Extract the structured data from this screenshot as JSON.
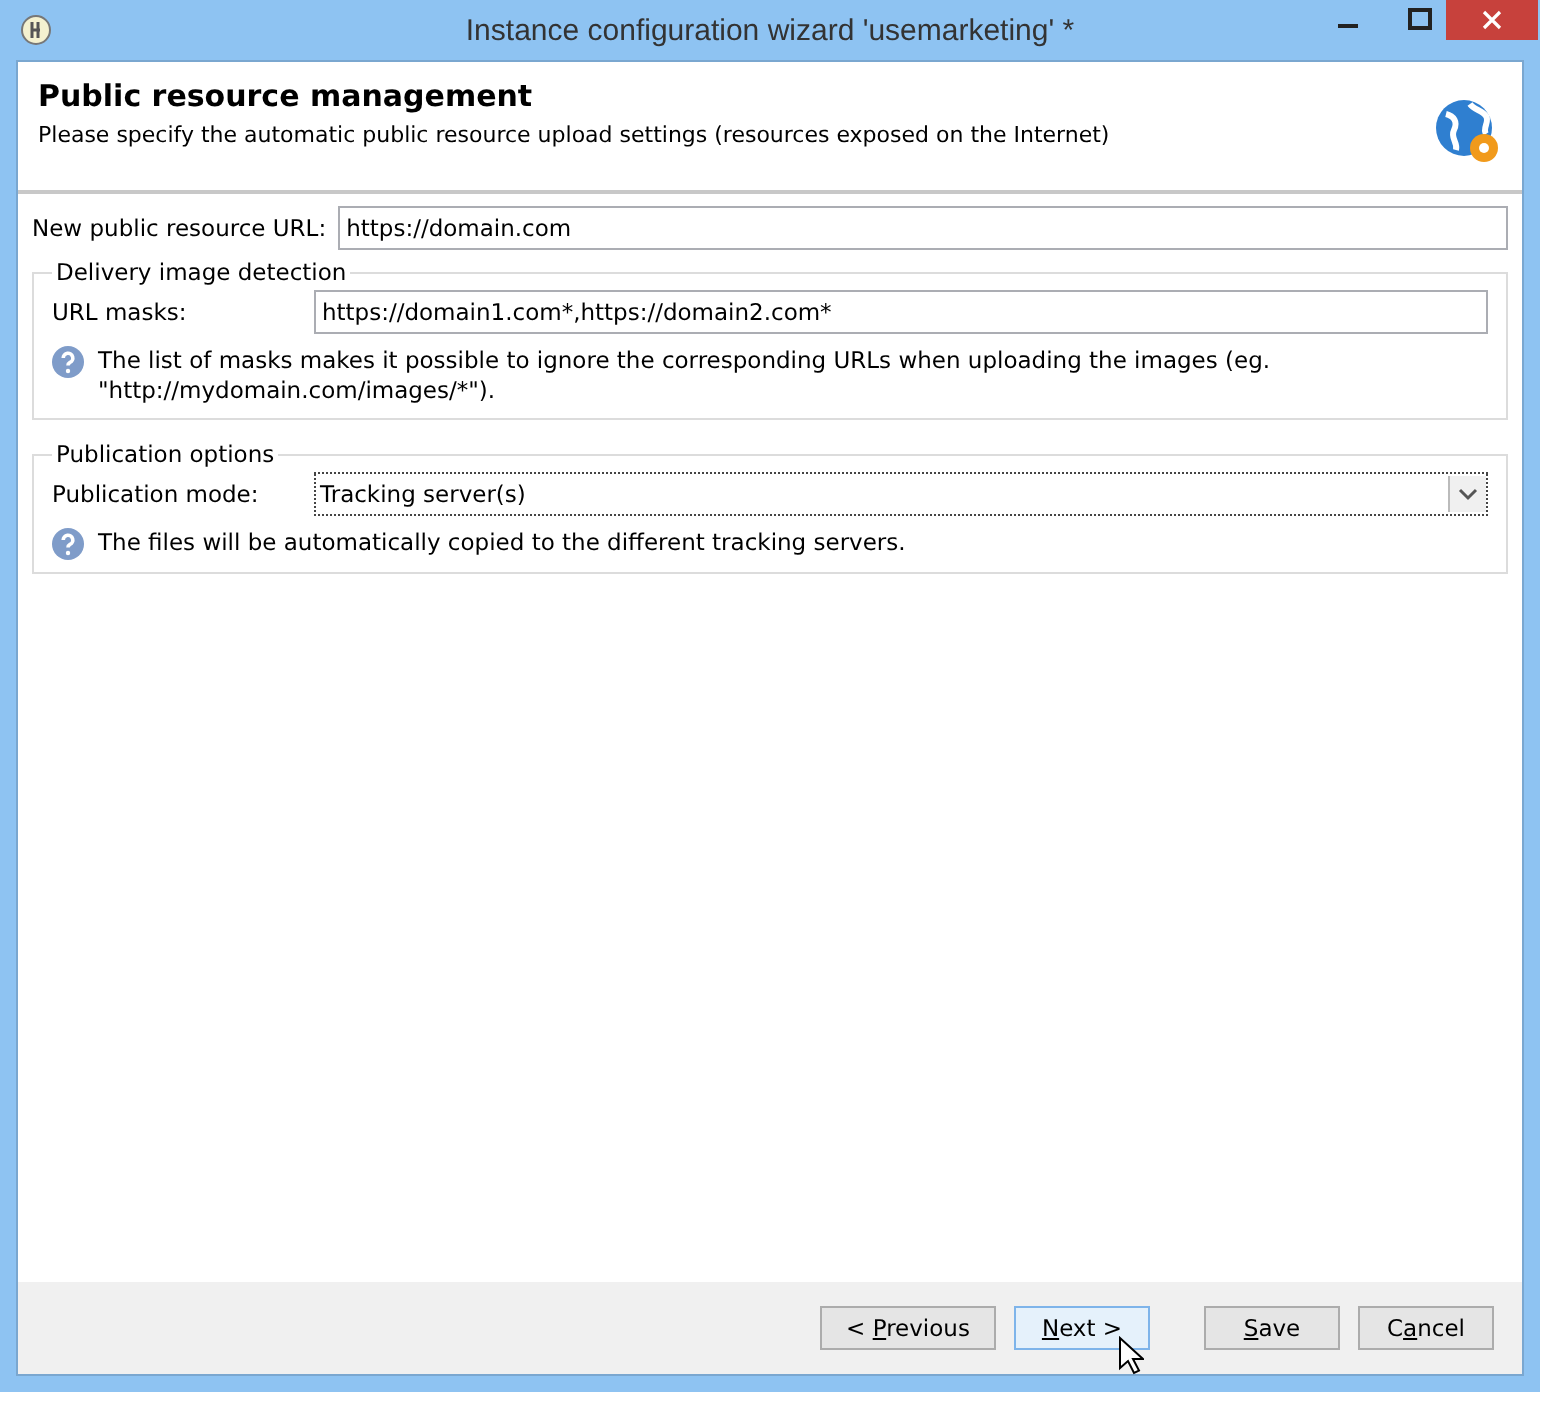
{
  "window": {
    "title": "Instance configuration wizard 'usemarketing' *"
  },
  "header": {
    "title": "Public resource management",
    "subtitle": "Please specify the automatic public resource upload settings (resources exposed on the Internet)"
  },
  "url_field": {
    "label": "New public resource URL:",
    "value": "https://domain.com"
  },
  "groups": [
    {
      "title": "Delivery image detection",
      "kind": "text",
      "label": "URL masks:",
      "value": "https://domain1.com*,https://domain2.com*",
      "help": "The list of masks makes it possible to ignore the corresponding URLs when uploading the images (eg. \"http://mydomain.com/images/*\")."
    },
    {
      "title": "Publication options",
      "kind": "dropdown",
      "label": "Publication mode:",
      "value": "Tracking server(s)",
      "help": "The files will be automatically copied to the different tracking servers."
    }
  ],
  "buttons": [
    {
      "pre": "< ",
      "key": "P",
      "post": "revious",
      "hovered": false
    },
    {
      "key": "N",
      "post": "ext >",
      "hovered": true
    },
    {
      "key": "S",
      "post": "ave",
      "hovered": false
    },
    {
      "pre": "C",
      "key": "a",
      "post": "ncel",
      "hovered": false
    }
  ]
}
